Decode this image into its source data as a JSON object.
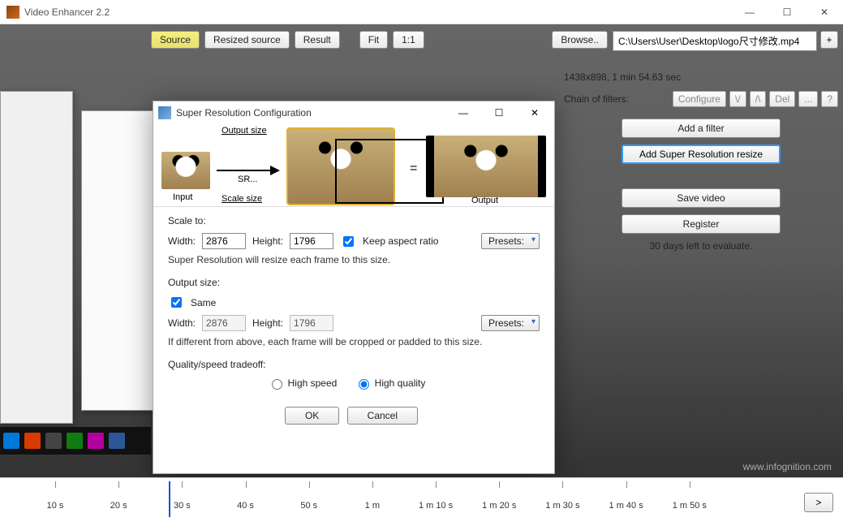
{
  "app": {
    "title": "Video Enhancer 2.2"
  },
  "toolbar": {
    "source": "Source",
    "resized": "Resized source",
    "result": "Result",
    "fit": "Fit",
    "oneToOne": "1:1",
    "browse": "Browse..",
    "path": "C:\\Users\\User\\Desktop\\logo尺寸修改.mp4",
    "plus": "+"
  },
  "info": {
    "dims": "1438x898, 1 min 54.63 sec",
    "chainLabel": "Chain of filters:",
    "configure": "Configure",
    "down": "\\/",
    "up": "/\\",
    "del": "Del",
    "dots": "...",
    "q": "?"
  },
  "panel": {
    "addFilter": "Add a filter",
    "addSR": "Add Super Resolution resize",
    "save": "Save video",
    "register": "Register",
    "evalText": "30 days left to evaluate."
  },
  "dialog": {
    "title": "Super Resolution Configuration",
    "demo": {
      "outputSize": "Output size",
      "sr": "SR...",
      "scaleSize": "Scale size",
      "input": "Input",
      "output": "Output",
      "eq": "="
    },
    "scale": {
      "heading": "Scale to:",
      "widthLabel": "Width:",
      "width": "2876",
      "heightLabel": "Height:",
      "height": "1796",
      "keepAspect": "Keep aspect ratio",
      "presets": "Presets:",
      "note": "Super Resolution will resize each frame to this size."
    },
    "output": {
      "heading": "Output size:",
      "same": "Same",
      "widthLabel": "Width:",
      "width": "2876",
      "heightLabel": "Height:",
      "height": "1796",
      "presets": "Presets:",
      "note": "If different from above, each frame will be cropped or padded to this size."
    },
    "quality": {
      "heading": "Quality/speed tradeoff:",
      "highSpeed": "High speed",
      "highQuality": "High quality"
    },
    "ok": "OK",
    "cancel": "Cancel"
  },
  "timeline": {
    "url": "www.infognition.com",
    "ticks": [
      "10 s",
      "20 s",
      "30 s",
      "40 s",
      "50 s",
      "1 m",
      "1 m 10 s",
      "1 m 20 s",
      "1 m 30 s",
      "1 m 40 s",
      "1 m 50 s"
    ],
    "play": ">"
  }
}
